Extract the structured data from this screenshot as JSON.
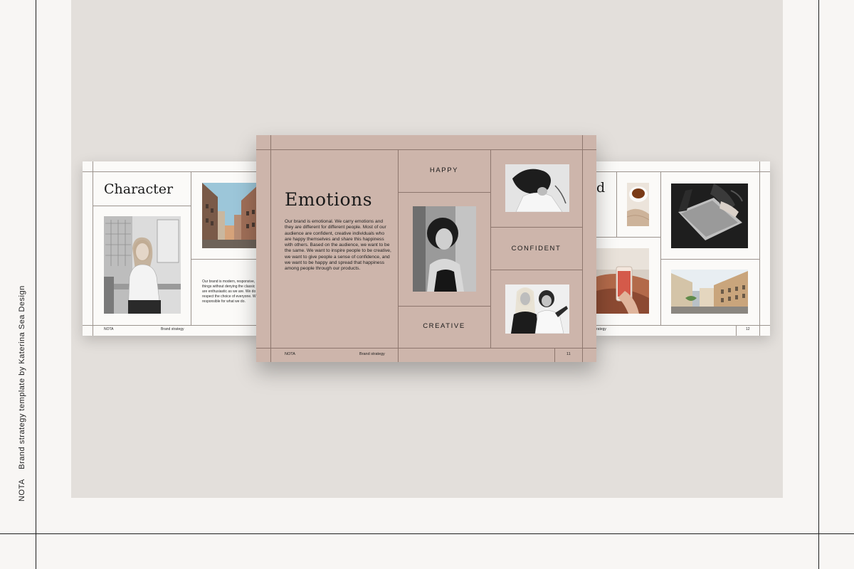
{
  "side_caption": {
    "brand": "NOTA",
    "text": "Brand strategy template by Katerina Sea Design"
  },
  "left_page": {
    "title": "Character",
    "body": "Our brand is modern, responsive, things without denying the classic are enthusiastic as we are. We do respect the choice of everyone. W responsible for what we do.",
    "footer_brand": "NOTA",
    "footer_label": "Brand strategy"
  },
  "center_page": {
    "title": "Emotions",
    "body": "Our brand is emotional. We carry emotions and they are different for different people. Most of our audience are confident, creative individuals who are happy themselves and share this happiness with others. Based on the audience, we want to be the same. We want to inspire people to be creative, we want to give people a sense of confidence, and we want to be happy and spread that happiness among people through our products.",
    "words": {
      "happy": "HAPPY",
      "confident": "CONFIDENT",
      "creative": "CREATIVE"
    },
    "footer_brand": "NOTA",
    "footer_label": "Brand strategy",
    "page_number": "11"
  },
  "right_page": {
    "title_fragment": "d",
    "footer_label": "rategy",
    "page_number": "12"
  },
  "colors": {
    "background": "#f8f6f4",
    "backdrop": "#e3dfdb",
    "accent_page": "#cdb5ab",
    "paper": "#fbfaf8"
  }
}
